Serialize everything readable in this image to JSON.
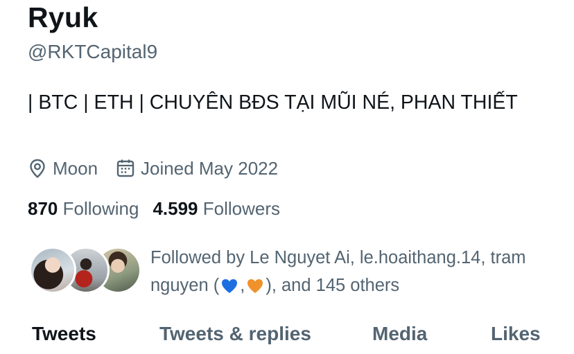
{
  "profile": {
    "name": "Ryuk",
    "handle": "@RKTCapital9",
    "bio": "| BTC | ETH | CHUYÊN BĐS TẠI MŨI NÉ, PHAN THIẾT",
    "location": "Moon",
    "joined": "Joined May 2022",
    "location_icon": "location-pin-icon",
    "calendar_icon": "calendar-icon"
  },
  "stats": {
    "following_count": "870",
    "following_label": "Following",
    "followers_count": "4.599",
    "followers_label": "Followers"
  },
  "followed_by": {
    "prefix": "Followed by Le Nguyet Ai, le.hoaithang.14, tram nguyen (",
    "separator": ",",
    "suffix": "), and 145 others",
    "heart_colors": [
      "#1d6fe0",
      "#f0922b"
    ]
  },
  "tabs": [
    {
      "label": "Tweets",
      "active": true
    },
    {
      "label": "Tweets & replies",
      "active": false
    },
    {
      "label": "Media",
      "active": false
    },
    {
      "label": "Likes",
      "active": false
    }
  ],
  "colors": {
    "text_primary": "#0f1419",
    "text_secondary": "#536471",
    "background": "#ffffff"
  }
}
